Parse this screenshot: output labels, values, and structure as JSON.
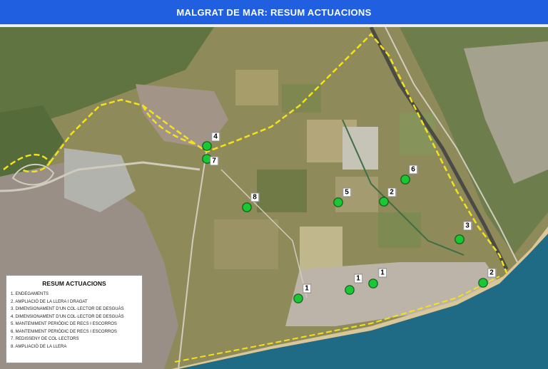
{
  "header": {
    "title": "MALGRAT DE MAR: RESUM ACTUACIONS",
    "color": "#1f5fe0"
  },
  "map": {
    "type": "aerial-photo",
    "boundary_line_color": "#f2e21d",
    "sea_color": "#1f6a84",
    "markers": [
      {
        "label": "4"
      },
      {
        "label": "7"
      },
      {
        "label": "8"
      },
      {
        "label": "5"
      },
      {
        "label": "2"
      },
      {
        "label": "6"
      },
      {
        "label": "3"
      },
      {
        "label": "2"
      },
      {
        "label": "1"
      },
      {
        "label": "1"
      },
      {
        "label": "1"
      }
    ]
  },
  "legend": {
    "title": "RESUM ACTUACIONS",
    "items": [
      "1. ENDEGAMENTS",
      "2. AMPLIACIÓ DE LA LLERA I DRAGAT",
      "3. DIMENSIONAMENT D'UN COL·LECTOR DE DESGUÀS",
      "4. DIMENSIONAMENT D'UN COL·LECTOR DE DESGUÀS",
      "5. MANTENIMENT PERIÒDIC DE RECS I ESCORROS",
      "6. MANTENIMENT PERIÒDIC DE RECS I ESCORROS",
      "7. REDISSENY DE COL·LECTORS",
      "8. AMPLIACIÓ DE LA LLERA"
    ]
  }
}
